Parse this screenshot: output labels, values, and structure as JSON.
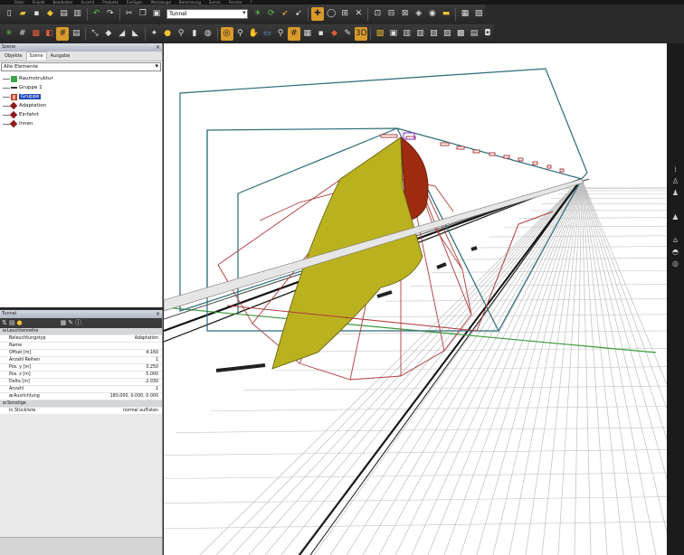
{
  "menubar": {
    "items": [
      "Datei",
      "Projekt",
      "Bearbeiten",
      "Ansicht",
      "Produkte",
      "Einfügen",
      "Werkzeuge",
      "Berechnung",
      "Extras",
      "Fenster",
      "?"
    ]
  },
  "toolbar": {
    "row1_icons": [
      "new-file",
      "open-folder",
      "save",
      "print",
      "cut",
      "undo",
      "redo",
      "scissors",
      "copy",
      "paste"
    ],
    "room_select": "Tunnel",
    "row1_icons_b": [
      "green-light",
      "rotate",
      "select-arrow",
      "move-cross",
      "rotate-circle",
      "crosshair",
      "grid-view",
      "grid-view",
      "grid-view",
      "tag",
      "ruler",
      "calculator",
      "report"
    ],
    "row2_icons": [
      "compass",
      "hash-grid",
      "plane",
      "hash-grid",
      "table",
      "sun",
      "stop",
      "pen",
      "luminaire",
      "lamp",
      "pin",
      "bulb",
      "magnifier",
      "pan",
      "zoom",
      "zoom-window",
      "grid-toggle",
      "grid",
      "box",
      "pencil",
      "tool",
      "3d-view",
      "color",
      "window",
      "document",
      "document",
      "document",
      "document",
      "document",
      "document",
      "document"
    ]
  },
  "scene_panel": {
    "title": "Szene",
    "tabs": [
      "Objekte",
      "Szene",
      "Ausgabe"
    ],
    "active_tab": "Szene",
    "filter": "Alle Elemente",
    "tree": [
      {
        "label": "Raumstruktur",
        "icon": "green"
      },
      {
        "label": "Gruppe 1",
        "icon": "dash"
      },
      {
        "label": "Gruppe",
        "icon": "grid",
        "selected": true
      },
      {
        "label": "Adaptation",
        "icon": "diamond"
      },
      {
        "label": "Einfahrt",
        "icon": "diamond"
      },
      {
        "label": "Innen",
        "icon": "diamond"
      }
    ]
  },
  "props_panel": {
    "title": "Tunnel",
    "category_main": "Leuchtenreihe",
    "rows": [
      {
        "k": "Beleuchtungstyp",
        "v": "Adaptation"
      },
      {
        "k": "Name",
        "v": ""
      },
      {
        "k": "Offset [m]",
        "v": "4.160"
      },
      {
        "k": "Anzahl Reihen",
        "v": "1"
      },
      {
        "k": "Pos. y [m]",
        "v": "3.250"
      },
      {
        "k": "Pos. z [m]",
        "v": "5.000"
      },
      {
        "k": "Delta [m]",
        "v": "2.030"
      },
      {
        "k": "Anzahl",
        "v": "1"
      },
      {
        "k": "Ausrichtung",
        "v": "180.000, 0.000, 0.000"
      }
    ],
    "category_other": "Sonstige",
    "rows_other": [
      {
        "k": "In Stückliste",
        "v": "normal auflisten"
      }
    ]
  },
  "colors": {
    "tunnel_box": "#2b6b77",
    "light_cone": "#b03a3a",
    "ceiling_surface": "#9e2a10",
    "luminance_surface": "#b9b11e",
    "axis_green": "#3c9a3c"
  }
}
